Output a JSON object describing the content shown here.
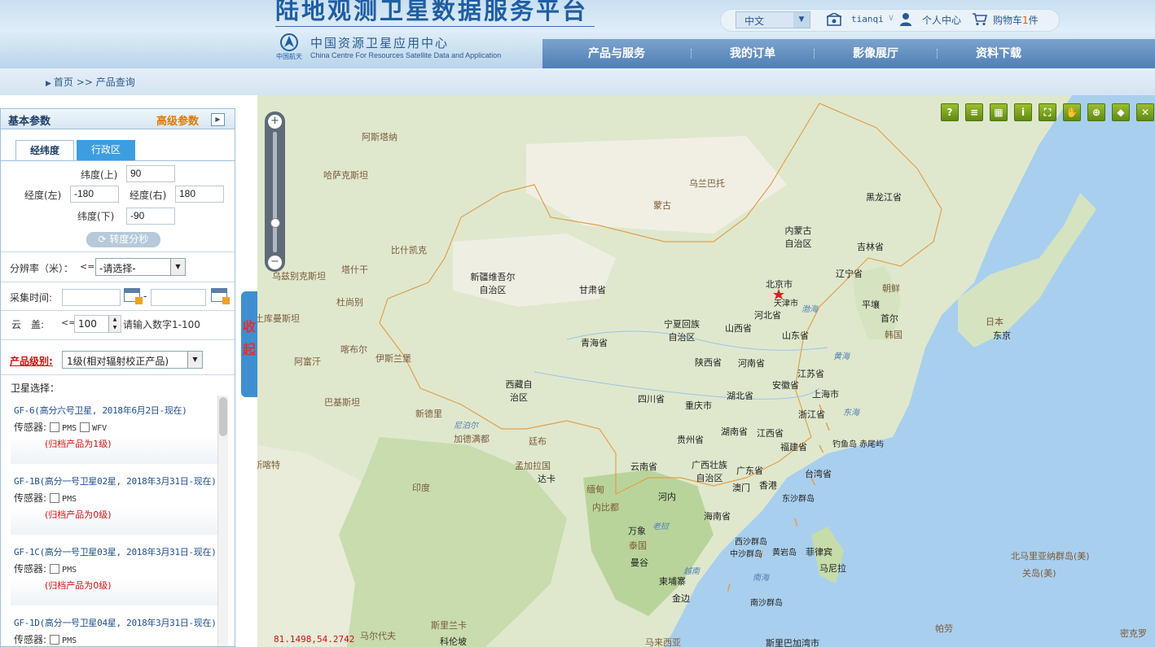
{
  "header": {
    "site_title": "陆地观测卫星数据服务平台",
    "org_cn": "中国资源卫星应用中心",
    "org_en": "China Centre For Resources Satellite Data and Application",
    "logo_text": "中国航天",
    "language": "中文",
    "username": "tianqi",
    "personal_center": "个人中心",
    "cart_prefix": "购物车",
    "cart_count": "1",
    "cart_suffix": "件"
  },
  "nav": {
    "items": [
      "产品与服务",
      "我的订单",
      "影像展厅",
      "资料下载"
    ]
  },
  "breadcrumb": {
    "home": "首页",
    "separator": ">>",
    "current": "产品查询"
  },
  "panel": {
    "title": "基本参数",
    "advanced": "高级参数",
    "tabs": [
      "经纬度",
      "行政区"
    ],
    "lat_top_label": "纬度(上)",
    "lat_top": "90",
    "lon_left_label": "经度(左)",
    "lon_left": "-180",
    "lon_right_label": "经度(右)",
    "lon_right": "180",
    "lat_bottom_label": "纬度(下)",
    "lat_bottom": "-90",
    "dms_button": "转度分秒",
    "resolution_label": "分辨率（米）：",
    "resolution_op": "<=",
    "resolution_value": "-请选择-",
    "time_label": "采集时间:",
    "time_sep": "-",
    "cloud_label": "云　盖:",
    "cloud_op": "<=",
    "cloud_value": "100",
    "cloud_hint": "请输入数字1-100",
    "level_label": "产品级别:",
    "level_value": "1级(相对辐射校正产品)",
    "sat_label": "卫星选择：",
    "sensor_label": "传感器:",
    "satellites": [
      {
        "name": "GF-6(高分六号卫星, 2018年6月2日-现在)",
        "sensors": [
          "PMS",
          "WFV"
        ],
        "archive": "(归档产品为1级)"
      },
      {
        "name": "GF-1B(高分一号卫星02星, 2018年3月31日-现在)",
        "sensors": [
          "PMS"
        ],
        "archive": "(归档产品为0级)"
      },
      {
        "name": "GF-1C(高分一号卫星03星, 2018年3月31日-现在)",
        "sensors": [
          "PMS"
        ],
        "archive": "(归档产品为0级)"
      },
      {
        "name": "GF-1D(高分一号卫星04星, 2018年3月31日-现在)",
        "sensors": [
          "PMS"
        ],
        "archive": ""
      }
    ]
  },
  "collapse": "收起",
  "map": {
    "coords": "81.1498,54.2742",
    "tools": [
      "?",
      "≡",
      "▦",
      "i",
      "⛶",
      "✋",
      "⊕",
      "◆",
      "✕"
    ],
    "labels": {
      "astana": "阿斯塔纳",
      "kazakhstan": "哈萨克斯坦",
      "ulaanbaatar": "乌兰巴托",
      "mongolia": "蒙古",
      "heilongjiang": "黑龙江省",
      "neimenggu": "内蒙古自治区",
      "jilin": "吉林省",
      "liaoning": "辽宁省",
      "bishkek": "比什凯克",
      "uzbekistan": "乌兹别克斯坦",
      "tashkent": "塔什干",
      "xinjiang": "新疆维吾尔自治区",
      "gansu": "甘肃省",
      "beijing": "北京市",
      "tianjin": "天津市",
      "hebei": "河北省",
      "korea_n": "朝鲜",
      "pyongyang": "平壤",
      "seoul": "首尔",
      "korea_s": "韩国",
      "japan": "日本",
      "tokyo": "东京",
      "dushanbe": "杜尚别",
      "turkmenistan": "土库曼斯坦",
      "bohai": "渤海",
      "ningxia": "宁夏回族自治区",
      "shanxi": "山西省",
      "shandong": "山东省",
      "kabul": "喀布尔",
      "islamabad": "伊斯兰堡",
      "afghanistan": "阿富汗",
      "qinghai": "青海省",
      "shaanxi": "陕西省",
      "henan": "河南省",
      "yellowsea": "黄海",
      "jiangsu": "江苏省",
      "anhui": "安徽省",
      "shanghai": "上海市",
      "pakistan": "巴基斯坦",
      "xizang": "西藏自治区",
      "sichuan": "四川省",
      "hubei": "湖北省",
      "eastsea": "东海",
      "newdelhi": "新德里",
      "nepal": "尼泊尔",
      "kathmandu": "加德满都",
      "chongqing": "重庆市",
      "zhejiang": "浙江省",
      "thimphu": "廷布",
      "guizhou": "贵州省",
      "hunan": "湖南省",
      "jiangxi": "江西省",
      "fujian": "福建省",
      "diaoyu": "钓鱼岛",
      "chiwei": "赤尾屿",
      "muscat": "马斯喀特",
      "bangladesh": "孟加拉国",
      "dhaka": "达卡",
      "yunnan": "云南省",
      "guangxi": "广西壮族自治区",
      "guangdong": "广东省",
      "taiwan": "台湾省",
      "india": "印度",
      "myanmar": "缅甸",
      "macau": "澳门",
      "hongkong": "香港",
      "dongsha": "东沙群岛",
      "hanoi": "河内",
      "naypyidaw": "内比都",
      "hainan": "海南省",
      "laos": "老挝",
      "thailand": "泰国",
      "vientiane": "万象",
      "xisha": "西沙群岛",
      "zhongsha": "中沙群岛",
      "huangyan": "黄岩岛",
      "philippines": "菲律宾",
      "manila": "马尼拉",
      "bangkok": "曼谷",
      "vietnam": "越南",
      "southsea": "南海",
      "mariana": "北马里亚纳群岛(美)",
      "guam": "关岛(美)",
      "cambodia": "柬埔寨",
      "phnompenh": "金边",
      "nansha": "南沙群岛",
      "srilanka": "斯里兰卡",
      "colombo": "科伦坡",
      "maldives": "马尔代夫",
      "palau": "帕劳",
      "malaysia": "马来西亚",
      "micronesia": "密克罗",
      "yunbo": "斯里巴加湾市"
    }
  }
}
